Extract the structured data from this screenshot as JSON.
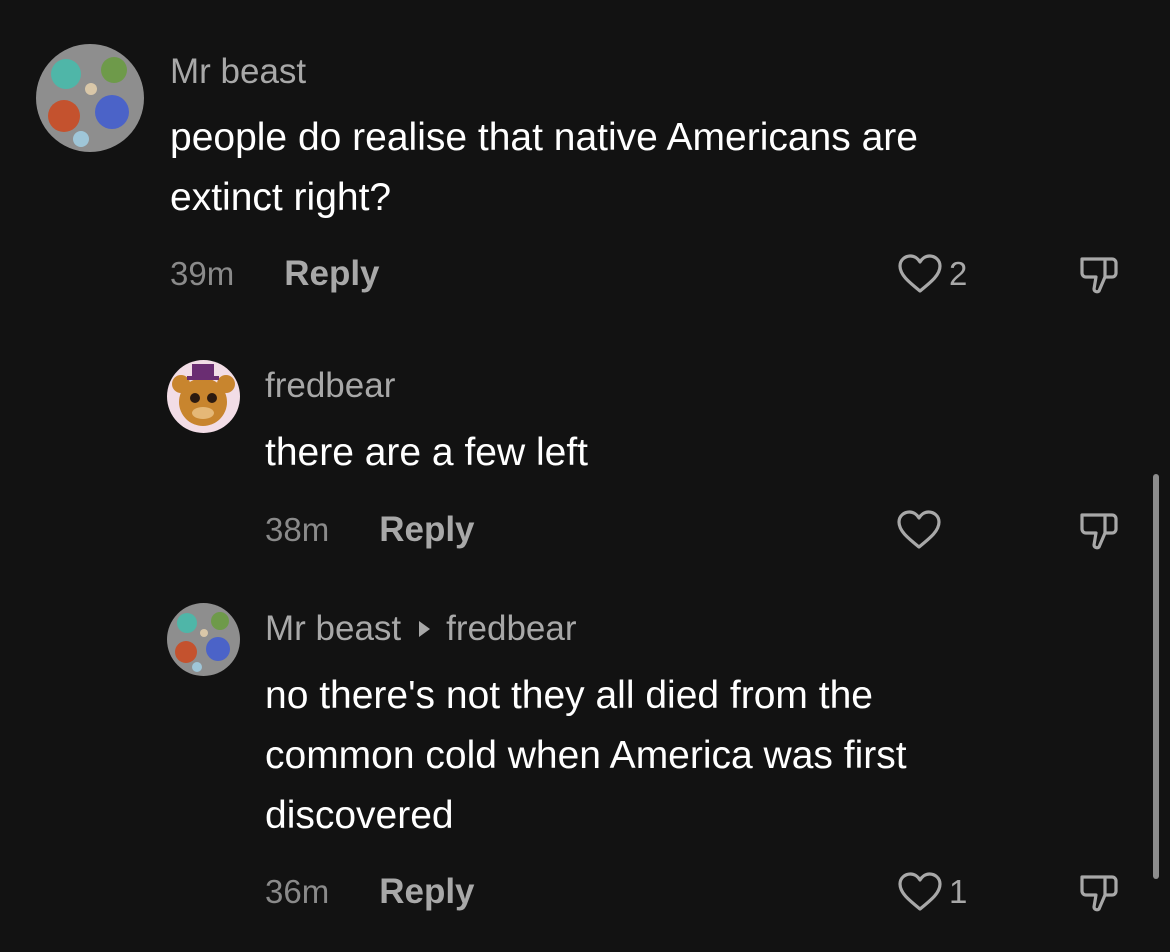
{
  "comments": [
    {
      "username": "Mr beast",
      "text_line1": "people do realise that native Americans are",
      "text_line2": "extinct right?",
      "time": "39m",
      "reply_label": "Reply",
      "likes": "2"
    },
    {
      "username": "fredbear",
      "text": "there are a few left",
      "time": "38m",
      "reply_label": "Reply",
      "likes": ""
    },
    {
      "username": "Mr beast",
      "reply_to": "fredbear",
      "text_line1": "no there's not they all died from the",
      "text_line2": "common cold when America was first",
      "text_line3": "discovered",
      "time": "36m",
      "reply_label": "Reply",
      "likes": "1"
    }
  ],
  "icons": {
    "like": "heart-outline-icon",
    "dislike": "thumbs-down-icon",
    "reply_arrow": "play-arrow-icon"
  },
  "colors": {
    "background": "#121212",
    "text": "#ffffff",
    "muted": "#a8a8a8"
  }
}
